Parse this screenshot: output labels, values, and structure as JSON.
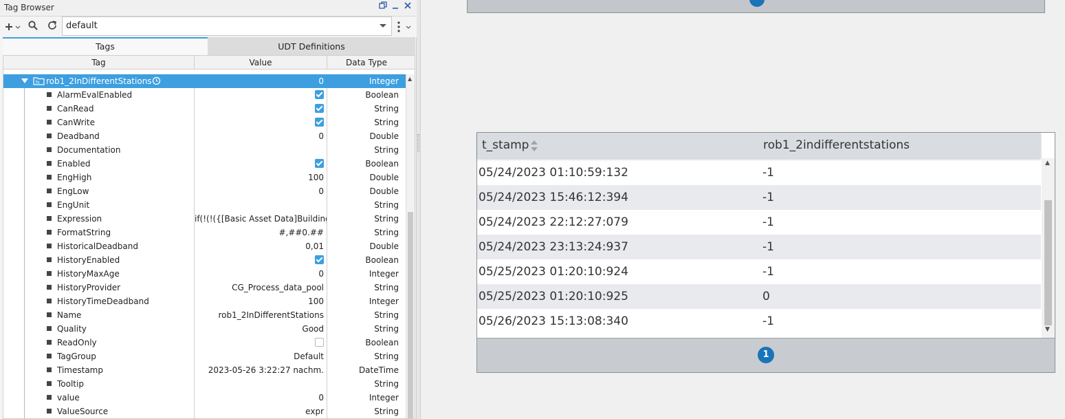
{
  "tag_browser": {
    "title": "Tag Browser",
    "provider": "default",
    "tabs": [
      "Tags",
      "UDT Definitions"
    ],
    "columns": [
      "Tag",
      "Value",
      "Data Type"
    ],
    "selected_tag": {
      "name": "rob1_2InDifferentStations",
      "value": "0",
      "type": "Integer"
    },
    "rows": [
      {
        "name": "AlarmEvalEnabled",
        "value": "",
        "checkbox": "on",
        "type": "Boolean"
      },
      {
        "name": "CanRead",
        "value": "",
        "checkbox": "on",
        "type": "String"
      },
      {
        "name": "CanWrite",
        "value": "",
        "checkbox": "on",
        "type": "String"
      },
      {
        "name": "Deadband",
        "value": "0",
        "type": "Double"
      },
      {
        "name": "Documentation",
        "value": "",
        "type": "String"
      },
      {
        "name": "Enabled",
        "value": "",
        "checkbox": "on",
        "type": "Boolean"
      },
      {
        "name": "EngHigh",
        "value": "100",
        "type": "Double"
      },
      {
        "name": "EngLow",
        "value": "0",
        "type": "Double"
      },
      {
        "name": "EngUnit",
        "value": "",
        "type": "String"
      },
      {
        "name": "Expression",
        "value": "if(!(!({[Basic Asset Data]Building...",
        "type": "String"
      },
      {
        "name": "FormatString",
        "value": "#,##0.##",
        "type": "String"
      },
      {
        "name": "HistoricalDeadband",
        "value": "0,01",
        "type": "Double"
      },
      {
        "name": "HistoryEnabled",
        "value": "",
        "checkbox": "on",
        "type": "Boolean"
      },
      {
        "name": "HistoryMaxAge",
        "value": "0",
        "type": "Integer"
      },
      {
        "name": "HistoryProvider",
        "value": "CG_Process_data_pool",
        "type": "String"
      },
      {
        "name": "HistoryTimeDeadband",
        "value": "100",
        "type": "Integer"
      },
      {
        "name": "Name",
        "value": "rob1_2InDifferentStations",
        "type": "String"
      },
      {
        "name": "Quality",
        "value": "Good",
        "type": "String"
      },
      {
        "name": "ReadOnly",
        "value": "",
        "checkbox": "off",
        "type": "Boolean"
      },
      {
        "name": "TagGroup",
        "value": "Default",
        "type": "String"
      },
      {
        "name": "Timestamp",
        "value": "2023-05-26 3:22:27 nachm.",
        "type": "DateTime"
      },
      {
        "name": "Tooltip",
        "value": "",
        "type": "String"
      },
      {
        "name": "value",
        "value": "0",
        "type": "Integer"
      },
      {
        "name": "ValueSource",
        "value": "expr",
        "type": "String"
      }
    ]
  },
  "history_table": {
    "columns": [
      "t_stamp",
      "rob1_2indifferentstations"
    ],
    "rows": [
      {
        "t_stamp": "05/24/2023 01:10:59:132",
        "value": "-1"
      },
      {
        "t_stamp": "05/24/2023 15:46:12:394",
        "value": "-1"
      },
      {
        "t_stamp": "05/24/2023 22:12:27:079",
        "value": "-1"
      },
      {
        "t_stamp": "05/24/2023 23:13:24:937",
        "value": "-1"
      },
      {
        "t_stamp": "05/25/2023 01:20:10:924",
        "value": "-1"
      },
      {
        "t_stamp": "05/25/2023 01:20:10:925",
        "value": "0"
      },
      {
        "t_stamp": "05/26/2023 15:13:08:340",
        "value": "-1"
      }
    ],
    "current_page": "1"
  },
  "colors": {
    "selection": "#3d9fe0",
    "page_indicator": "#1a74b8",
    "accent_tab": "#3ea0dc"
  },
  "icons": [
    "add-icon",
    "search-icon",
    "refresh-icon",
    "kebab-menu-icon",
    "restore-icon",
    "minimize-icon",
    "close-icon",
    "expression-tag-icon",
    "history-clock-icon",
    "sort-icon"
  ]
}
